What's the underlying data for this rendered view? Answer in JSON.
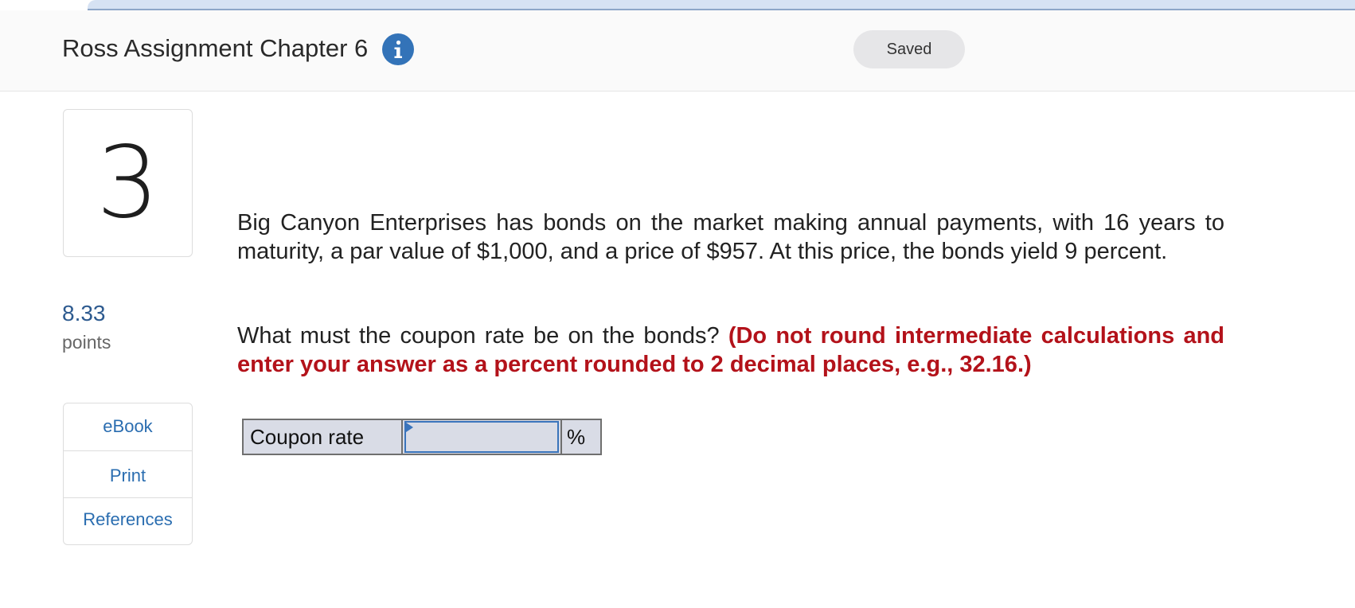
{
  "header": {
    "assignment_title": "Ross Assignment Chapter 6",
    "info_icon": "info-icon",
    "status": "Saved"
  },
  "question": {
    "number": "3",
    "points_value": "8.33",
    "points_label": "points",
    "text": "Big Canyon Enterprises has bonds on the market making annual payments, with 16 years to maturity, a par value of $1,000, and a price of $957. At this price, the bonds yield 9 percent.",
    "prompt": "What must the coupon rate be on the bonds?",
    "instruction": "(Do not round intermediate calculations and enter your answer as a percent rounded to 2 decimal places, e.g., 32.16.)"
  },
  "resources": [
    {
      "label": "eBook"
    },
    {
      "label": "Print"
    },
    {
      "label": "References"
    }
  ],
  "answer": {
    "label": "Coupon rate",
    "value": "",
    "unit": "%"
  },
  "colors": {
    "accent_blue": "#3373b8",
    "link_blue": "#2a6db0",
    "instruction_red": "#b3121a",
    "input_background": "#d9dce6"
  }
}
